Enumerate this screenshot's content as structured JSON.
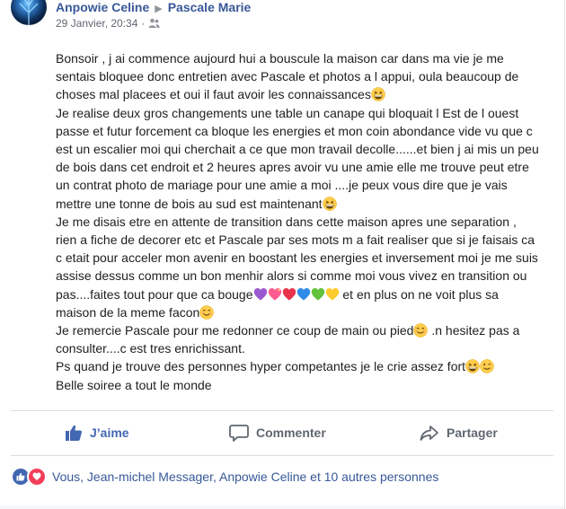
{
  "post": {
    "author": "Anpowie Celine",
    "recipient": "Pascale Marie",
    "timestamp": "29 Janvier, 20:34",
    "privacy_icon": "friends-icon",
    "lines": [
      {
        "text": "Bonsoir , j ai commence aujourd hui a bouscule la maison car dans ma vie je me sentais bloquee donc entretien avec Pascale et photos a l appui, oula beaucoup de choses mal placees et oui il faut avoir les connaissances",
        "emojis_after": [
          "grinning-squint-emoji"
        ]
      },
      {
        "text": "Je realise deux gros changements une table un canape qui bloquait l Est de l ouest passe et futur forcement ca bloque les energies et mon coin abondance vide vu que c est un escalier moi qui cherchait a ce que mon travail decolle......et bien j ai mis un peu de bois dans cet endroit et 2 heures apres avoir vu une amie elle me trouve peut etre un contrat photo de mariage pour une amie a moi ....je peux vous dire que je vais mettre une tonne de bois au sud est maintenant",
        "emojis_after": [
          "grinning-squint-emoji"
        ]
      },
      {
        "text": "Je me disais etre en attente de transition dans cette maison apres une separation , rien a fiche de decorer etc et Pascale par ses mots m a fait realiser que si je faisais ca c etait pour acceler mon avenir en boostant les energies et inversement moi je me suis assise dessus comme un bon menhir alors si comme moi vous vivez en transition ou pas....faites tout pour que ca bouge",
        "emojis_after": [
          "purple-heart-emoji",
          "sparkling-heart-emoji",
          "red-heart-emoji",
          "blue-heart-emoji",
          "green-heart-emoji",
          "yellow-heart-emoji"
        ],
        "text_after": " et en plus on ne voit plus sa maison de la meme facon",
        "emojis_end": [
          "smiling-emoji"
        ]
      },
      {
        "text": "Je remercie Pascale pour me redonner ce coup de main ou pied",
        "emojis_after": [
          "smiling-emoji"
        ],
        "text_after": " .n hesitez pas a consulter....c est tres enrichissant."
      },
      {
        "text": "Ps quand je trouve des personnes hyper competantes je le crie assez fort",
        "emojis_after": [
          "grinning-squint-emoji",
          "winking-emoji"
        ]
      },
      {
        "text": "Belle soiree a tout le monde",
        "emojis_after": []
      }
    ]
  },
  "actions": {
    "like_label": "J’aime",
    "comment_label": "Commenter",
    "share_label": "Partager"
  },
  "reactions": {
    "icons": [
      "like-reaction-icon",
      "love-reaction-icon"
    ],
    "summary": "Vous, Jean-michel Messager, Anpowie Celine et 10 autres personnes"
  },
  "colors": {
    "link_blue": "#385898",
    "like_blue": "#4267b2",
    "text": "#1c1e21",
    "muted": "#616770",
    "love_red": "#f33e58"
  }
}
